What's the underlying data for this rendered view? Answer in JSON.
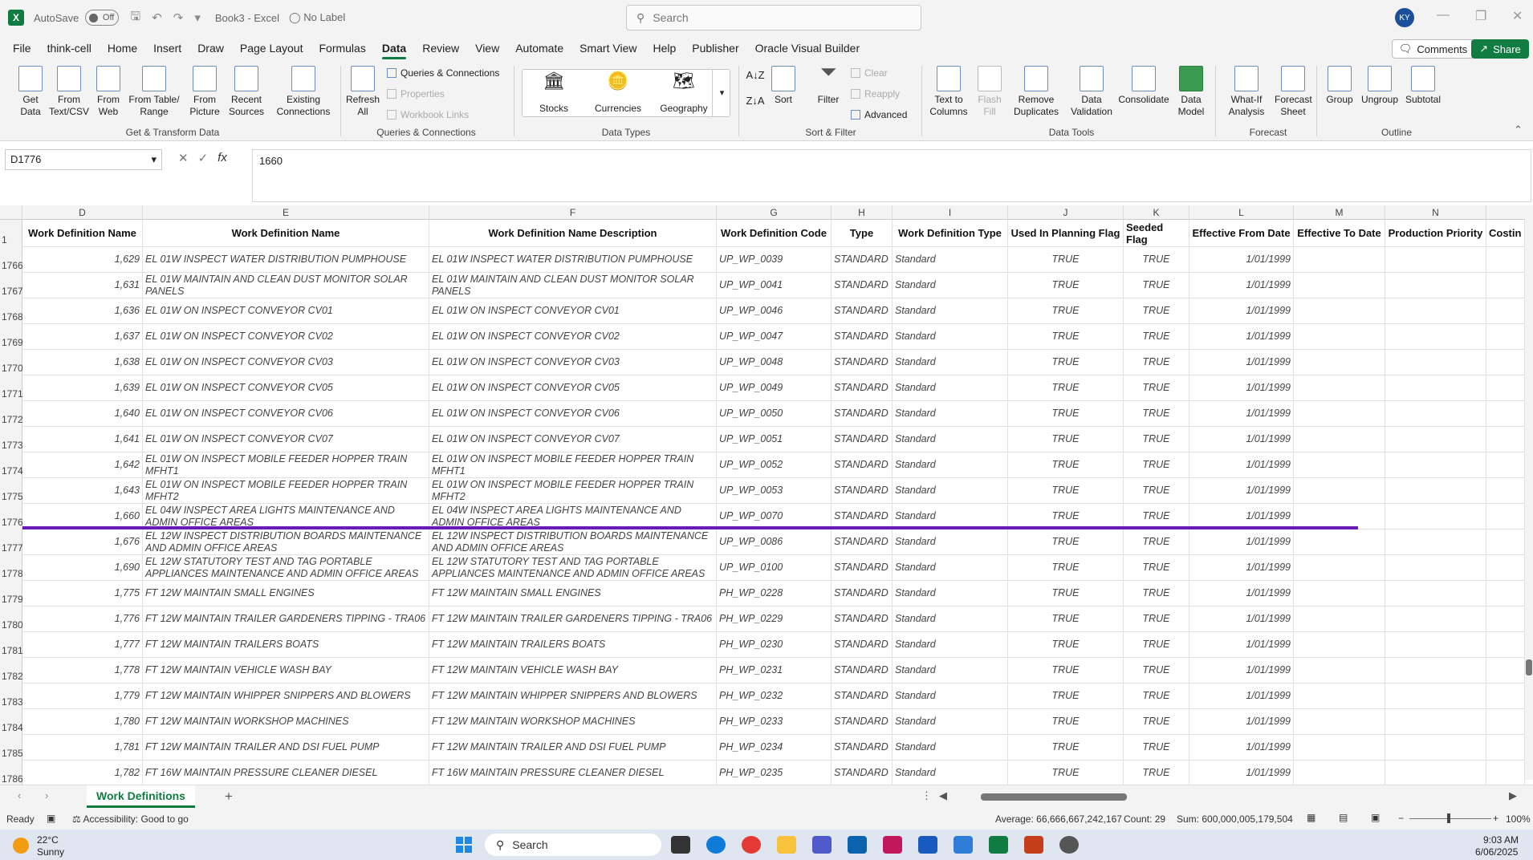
{
  "titlebar": {
    "autosave_label": "AutoSave",
    "autosave_state": "Off",
    "doc_title": "Book3 - Excel",
    "label_status": "No Label",
    "search_placeholder": "Search",
    "user_initials": "KY"
  },
  "menu": [
    "File",
    "think-cell",
    "Home",
    "Insert",
    "Draw",
    "Page Layout",
    "Formulas",
    "Data",
    "Review",
    "View",
    "Automate",
    "Smart View",
    "Help",
    "Publisher",
    "Oracle Visual Builder"
  ],
  "menu_active": "Data",
  "header_buttons": {
    "comments": "Comments",
    "share": "Share"
  },
  "ribbon": {
    "get_data": "Get Data",
    "from_text": "From Text/CSV",
    "from_web": "From Web",
    "from_table": "From Table/ Range",
    "from_picture": "From Picture",
    "recent_sources": "Recent Sources",
    "existing_connections": "Existing Connections",
    "group_get_transform": "Get & Transform Data",
    "refresh_all": "Refresh All",
    "queries_connections": "Queries & Connections",
    "properties": "Properties",
    "workbook_links": "Workbook Links",
    "group_queries": "Queries & Connections",
    "stocks": "Stocks",
    "currencies": "Currencies",
    "geography": "Geography",
    "group_data_types": "Data Types",
    "sort": "Sort",
    "filter": "Filter",
    "clear": "Clear",
    "reapply": "Reapply",
    "advanced": "Advanced",
    "group_sort_filter": "Sort & Filter",
    "text_to_columns": "Text to Columns",
    "flash_fill": "Flash Fill",
    "remove_duplicates": "Remove Duplicates",
    "data_validation": "Data Validation",
    "consolidate": "Consolidate",
    "data_model": "Data Model",
    "group_data_tools": "Data Tools",
    "what_if": "What-If Analysis",
    "forecast_sheet": "Forecast Sheet",
    "group_forecast": "Forecast",
    "group_btn": "Group",
    "ungroup": "Ungroup",
    "subtotal": "Subtotal",
    "group_outline": "Outline"
  },
  "formula_bar": {
    "name_box": "D1776",
    "formula": "1660"
  },
  "columns": [
    "D",
    "E",
    "F",
    "G",
    "H",
    "I",
    "J",
    "K",
    "L",
    "M",
    "N"
  ],
  "header_row": {
    "row_num": "1",
    "cells": [
      "Work Definition Name",
      "Work Definition Name",
      "Work Definition Name Description",
      "Work Definition Code",
      "Type",
      "Work Definition Type",
      "Used In Planning Flag",
      "Seeded Flag",
      "Effective From Date",
      "Effective To Date",
      "Production Priority",
      "Costin"
    ]
  },
  "rows": [
    {
      "n": "1766",
      "d": "1,629",
      "e": "EL 01W INSPECT WATER DISTRIBUTION PUMPHOUSE",
      "f": "EL 01W INSPECT WATER DISTRIBUTION PUMPHOUSE",
      "g": "UP_WP_0039",
      "h": "STANDARD",
      "i": "Standard",
      "j": "TRUE",
      "k": "TRUE",
      "l": "1/01/1999"
    },
    {
      "n": "1767",
      "d": "1,631",
      "e": "EL 01W MAINTAIN AND CLEAN DUST MONITOR SOLAR PANELS",
      "f": "EL 01W MAINTAIN AND CLEAN DUST MONITOR SOLAR PANELS",
      "g": "UP_WP_0041",
      "h": "STANDARD",
      "i": "Standard",
      "j": "TRUE",
      "k": "TRUE",
      "l": "1/01/1999"
    },
    {
      "n": "1768",
      "d": "1,636",
      "e": "EL 01W ON INSPECT CONVEYOR CV01",
      "f": "EL 01W ON INSPECT CONVEYOR CV01",
      "g": "UP_WP_0046",
      "h": "STANDARD",
      "i": "Standard",
      "j": "TRUE",
      "k": "TRUE",
      "l": "1/01/1999"
    },
    {
      "n": "1769",
      "d": "1,637",
      "e": "EL 01W ON INSPECT CONVEYOR CV02",
      "f": "EL 01W ON INSPECT CONVEYOR CV02",
      "g": "UP_WP_0047",
      "h": "STANDARD",
      "i": "Standard",
      "j": "TRUE",
      "k": "TRUE",
      "l": "1/01/1999"
    },
    {
      "n": "1770",
      "d": "1,638",
      "e": "EL 01W ON INSPECT CONVEYOR CV03",
      "f": "EL 01W ON INSPECT CONVEYOR CV03",
      "g": "UP_WP_0048",
      "h": "STANDARD",
      "i": "Standard",
      "j": "TRUE",
      "k": "TRUE",
      "l": "1/01/1999"
    },
    {
      "n": "1771",
      "d": "1,639",
      "e": "EL 01W ON INSPECT CONVEYOR CV05",
      "f": "EL 01W ON INSPECT CONVEYOR CV05",
      "g": "UP_WP_0049",
      "h": "STANDARD",
      "i": "Standard",
      "j": "TRUE",
      "k": "TRUE",
      "l": "1/01/1999"
    },
    {
      "n": "1772",
      "d": "1,640",
      "e": "EL 01W ON INSPECT CONVEYOR CV06",
      "f": "EL 01W ON INSPECT CONVEYOR CV06",
      "g": "UP_WP_0050",
      "h": "STANDARD",
      "i": "Standard",
      "j": "TRUE",
      "k": "TRUE",
      "l": "1/01/1999"
    },
    {
      "n": "1773",
      "d": "1,641",
      "e": "EL 01W ON INSPECT CONVEYOR CV07",
      "f": "EL 01W ON INSPECT CONVEYOR CV07",
      "g": "UP_WP_0051",
      "h": "STANDARD",
      "i": "Standard",
      "j": "TRUE",
      "k": "TRUE",
      "l": "1/01/1999"
    },
    {
      "n": "1774",
      "d": "1,642",
      "e": "EL 01W ON INSPECT MOBILE FEEDER HOPPER TRAIN MFHT1",
      "f": "EL 01W ON INSPECT MOBILE FEEDER HOPPER TRAIN MFHT1",
      "g": "UP_WP_0052",
      "h": "STANDARD",
      "i": "Standard",
      "j": "TRUE",
      "k": "TRUE",
      "l": "1/01/1999"
    },
    {
      "n": "1775",
      "d": "1,643",
      "e": "EL 01W ON INSPECT MOBILE FEEDER HOPPER TRAIN MFHT2",
      "f": "EL 01W ON INSPECT MOBILE FEEDER HOPPER TRAIN MFHT2",
      "g": "UP_WP_0053",
      "h": "STANDARD",
      "i": "Standard",
      "j": "TRUE",
      "k": "TRUE",
      "l": "1/01/1999"
    },
    {
      "n": "1776",
      "d": "1,660",
      "e": "EL 04W INSPECT AREA LIGHTS MAINTENANCE AND ADMIN OFFICE AREAS",
      "f": "EL 04W INSPECT AREA LIGHTS MAINTENANCE AND ADMIN OFFICE AREAS",
      "g": "UP_WP_0070",
      "h": "STANDARD",
      "i": "Standard",
      "j": "TRUE",
      "k": "TRUE",
      "l": "1/01/1999"
    },
    {
      "n": "1777",
      "d": "1,676",
      "e": "EL 12W INSPECT DISTRIBUTION BOARDS MAINTENANCE AND ADMIN OFFICE AREAS",
      "f": "EL 12W INSPECT DISTRIBUTION BOARDS MAINTENANCE AND ADMIN OFFICE AREAS",
      "g": "UP_WP_0086",
      "h": "STANDARD",
      "i": "Standard",
      "j": "TRUE",
      "k": "TRUE",
      "l": "1/01/1999"
    },
    {
      "n": "1778",
      "d": "1,690",
      "e": "EL 12W STATUTORY TEST AND TAG PORTABLE APPLIANCES MAINTENANCE AND ADMIN OFFICE AREAS",
      "f": "EL 12W STATUTORY TEST AND TAG PORTABLE APPLIANCES MAINTENANCE AND ADMIN OFFICE AREAS",
      "g": "UP_WP_0100",
      "h": "STANDARD",
      "i": "Standard",
      "j": "TRUE",
      "k": "TRUE",
      "l": "1/01/1999"
    },
    {
      "n": "1779",
      "d": "1,775",
      "e": "FT 12W MAINTAIN SMALL ENGINES",
      "f": "FT 12W MAINTAIN SMALL ENGINES",
      "g": "PH_WP_0228",
      "h": "STANDARD",
      "i": "Standard",
      "j": "TRUE",
      "k": "TRUE",
      "l": "1/01/1999"
    },
    {
      "n": "1780",
      "d": "1,776",
      "e": "FT 12W MAINTAIN TRAILER GARDENERS TIPPING - TRA06",
      "f": "FT 12W MAINTAIN TRAILER GARDENERS TIPPING - TRA06",
      "g": "PH_WP_0229",
      "h": "STANDARD",
      "i": "Standard",
      "j": "TRUE",
      "k": "TRUE",
      "l": "1/01/1999"
    },
    {
      "n": "1781",
      "d": "1,777",
      "e": "FT 12W MAINTAIN TRAILERS BOATS",
      "f": "FT 12W MAINTAIN TRAILERS BOATS",
      "g": "PH_WP_0230",
      "h": "STANDARD",
      "i": "Standard",
      "j": "TRUE",
      "k": "TRUE",
      "l": "1/01/1999"
    },
    {
      "n": "1782",
      "d": "1,778",
      "e": "FT 12W MAINTAIN VEHICLE WASH BAY",
      "f": "FT 12W MAINTAIN VEHICLE WASH BAY",
      "g": "PH_WP_0231",
      "h": "STANDARD",
      "i": "Standard",
      "j": "TRUE",
      "k": "TRUE",
      "l": "1/01/1999"
    },
    {
      "n": "1783",
      "d": "1,779",
      "e": "FT 12W MAINTAIN WHIPPER SNIPPERS AND BLOWERS",
      "f": "FT 12W MAINTAIN WHIPPER SNIPPERS AND BLOWERS",
      "g": "PH_WP_0232",
      "h": "STANDARD",
      "i": "Standard",
      "j": "TRUE",
      "k": "TRUE",
      "l": "1/01/1999"
    },
    {
      "n": "1784",
      "d": "1,780",
      "e": "FT 12W MAINTAIN WORKSHOP MACHINES",
      "f": "FT 12W MAINTAIN WORKSHOP MACHINES",
      "g": "PH_WP_0233",
      "h": "STANDARD",
      "i": "Standard",
      "j": "TRUE",
      "k": "TRUE",
      "l": "1/01/1999"
    },
    {
      "n": "1785",
      "d": "1,781",
      "e": "FT 12W MAINTAIN TRAILER AND DSI FUEL PUMP",
      "f": "FT 12W MAINTAIN TRAILER AND DSI FUEL PUMP",
      "g": "PH_WP_0234",
      "h": "STANDARD",
      "i": "Standard",
      "j": "TRUE",
      "k": "TRUE",
      "l": "1/01/1999"
    },
    {
      "n": "1786",
      "d": "1,782",
      "e": "FT 16W MAINTAIN PRESSURE CLEANER DIESEL",
      "f": "FT 16W MAINTAIN PRESSURE CLEANER DIESEL",
      "g": "PH_WP_0235",
      "h": "STANDARD",
      "i": "Standard",
      "j": "TRUE",
      "k": "TRUE",
      "l": "1/01/1999"
    }
  ],
  "sheet_tab": "Work Definitions",
  "status": {
    "ready": "Ready",
    "accessibility": "Accessibility: Good to go",
    "average": "Average: 66,666,667,242,167",
    "count": "Count: 29",
    "sum": "Sum: 600,000,005,179,504",
    "zoom": "100%"
  },
  "taskbar": {
    "temp": "22°C",
    "weather": "Sunny",
    "search": "Search",
    "time": "9:03 AM",
    "date": "6/06/2025"
  },
  "colors": {
    "excel_green": "#107c41",
    "purple_line": "#6a1bb5"
  }
}
